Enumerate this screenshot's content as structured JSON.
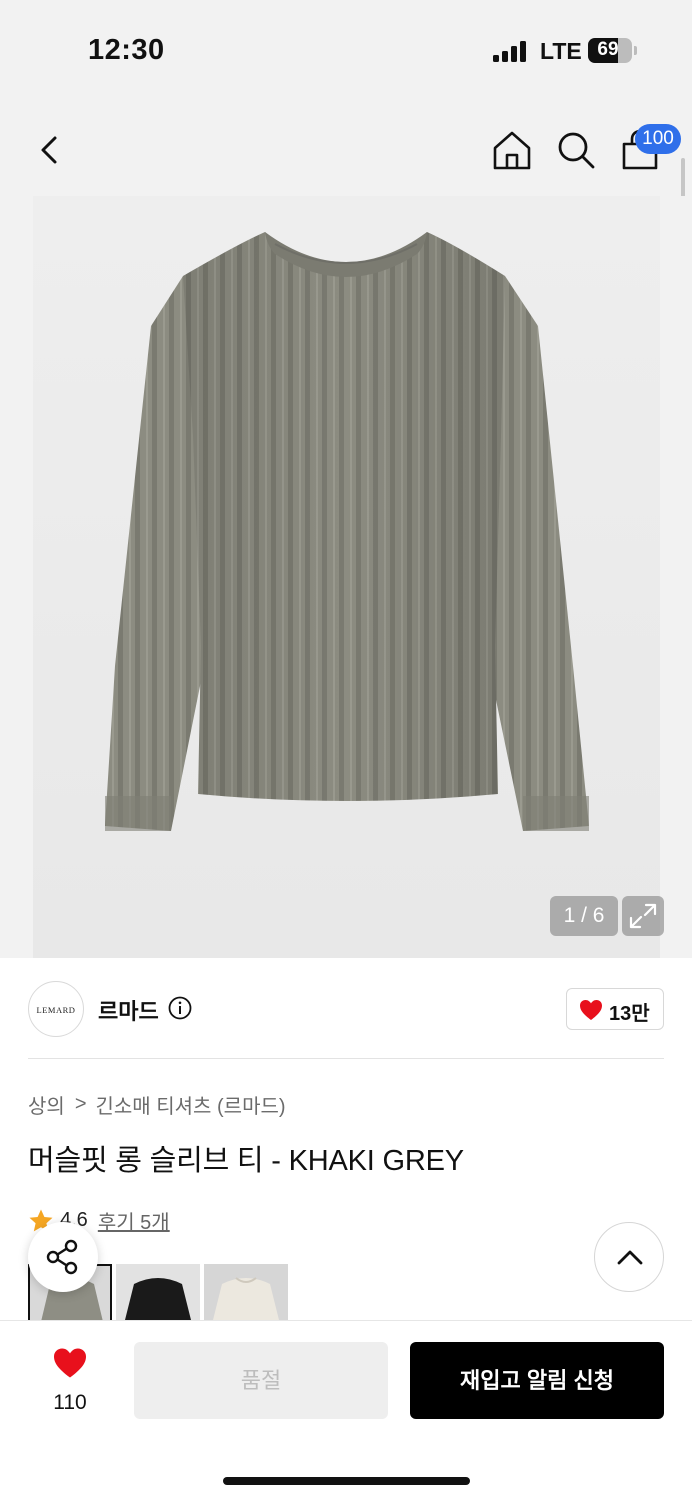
{
  "status_bar": {
    "time": "12:30",
    "network": "LTE",
    "battery": "69",
    "battery_level": 0.69
  },
  "nav": {
    "back_icon": "chevron-left-icon",
    "home_icon": "home-icon",
    "search_icon": "search-icon",
    "cart_icon": "shopping-bag-icon",
    "cart_badge": "100",
    "badge_color": "#2f6fea"
  },
  "gallery": {
    "counter": "1 / 6",
    "current": 1,
    "total": 6,
    "expand_icon": "expand-icon"
  },
  "brand": {
    "logo_text": "LEMARD",
    "name": "르마드",
    "info_icon": "info-icon",
    "likes": "13만"
  },
  "breadcrumb": {
    "items": [
      "상의",
      "긴소매 티셔츠 (르마드)"
    ],
    "separator": ">"
  },
  "product": {
    "title": "머슬핏 롱 슬리브 티 - KHAKI GREY",
    "rating": "4.6",
    "review_link": "후기 5개",
    "star_color": "#f5a623"
  },
  "swatches": [
    {
      "name": "KHAKI GREY",
      "color": "#8e8e84",
      "selected": true
    },
    {
      "name": "BLACK",
      "color": "#1a1a1a",
      "selected": false
    },
    {
      "name": "IVORY",
      "color": "#ece8df",
      "selected": false
    }
  ],
  "floating": {
    "share_icon": "share-icon",
    "top_icon": "chevron-up-icon"
  },
  "bottom_bar": {
    "wish_count": "110",
    "wish_color": "#e8101c",
    "soldout_label": "품절",
    "restock_label": "재입고 알림 신청"
  }
}
